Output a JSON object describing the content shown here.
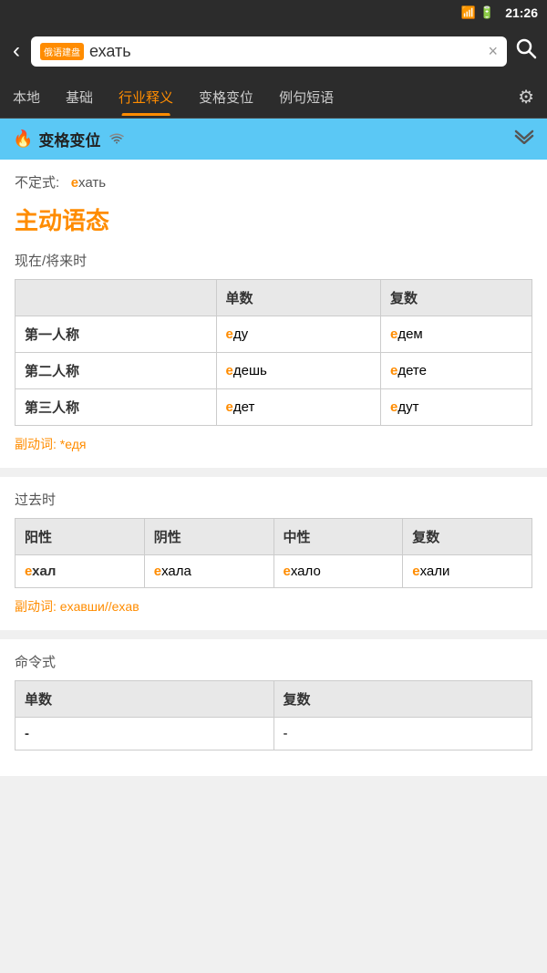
{
  "statusBar": {
    "time": "21:26",
    "signal": "4G",
    "battery": "▓▓▓"
  },
  "searchBar": {
    "backIcon": "‹",
    "badge": "俄语建盘",
    "query": "ехать",
    "clearIcon": "×",
    "searchIcon": "🔍"
  },
  "navTabs": [
    {
      "id": "local",
      "label": "本地",
      "active": false
    },
    {
      "id": "basic",
      "label": "基础",
      "active": false
    },
    {
      "id": "industry",
      "label": "行业释义",
      "active": true
    },
    {
      "id": "conjugation",
      "label": "变格变位",
      "active": false
    },
    {
      "id": "examples",
      "label": "例句短语",
      "active": false
    }
  ],
  "settingsIcon": "⚙",
  "sectionHeader": {
    "fireIcon": "🔥",
    "title": "变格变位",
    "wifiIcon": "≈",
    "chevron": "≫"
  },
  "infinitive": {
    "label": "不定式:",
    "prefix": "е",
    "rest": "хать"
  },
  "voiceTitle": "主动语态",
  "presentTense": {
    "label": "现在/将来时",
    "headers": [
      "",
      "单数",
      "复数"
    ],
    "rows": [
      {
        "person": "第一人称",
        "singular_prefix": "е",
        "singular_rest": "ду",
        "plural_prefix": "е",
        "plural_rest": "дем"
      },
      {
        "person": "第二人称",
        "singular_prefix": "е",
        "singular_rest": "дешь",
        "plural_prefix": "е",
        "plural_rest": "дете"
      },
      {
        "person": "第三人称",
        "singular_prefix": "е",
        "singular_rest": "дет",
        "plural_prefix": "е",
        "plural_rest": "дут"
      }
    ],
    "participle_label": "副动词:",
    "participle_prefix": "*е",
    "participle_rest": "дя"
  },
  "pastTense": {
    "label": "过去时",
    "headers": [
      "阳性",
      "阴性",
      "中性",
      "复数"
    ],
    "rows": [
      {
        "masc_prefix": "е",
        "masc_rest": "хал",
        "fem_prefix": "е",
        "fem_rest": "хала",
        "neut_prefix": "е",
        "neut_rest": "хало",
        "plur_prefix": "е",
        "plur_rest": "хали"
      }
    ],
    "participle_label": "副动词:",
    "participle_text": "еxавши//еxав"
  },
  "imperativeTense": {
    "label": "命令式",
    "headers": [
      "单数",
      "复数"
    ],
    "rows": [
      {
        "singular": "-",
        "plural": "-"
      }
    ]
  }
}
